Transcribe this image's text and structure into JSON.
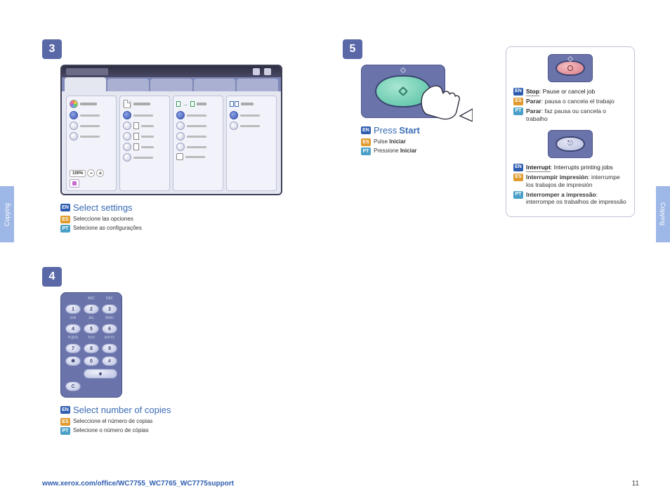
{
  "side_tab": "Copying",
  "footer": {
    "url": "www.xerox.com/office/WC7755_WC7765_WC7775support",
    "page": "11"
  },
  "step3": {
    "num": "3",
    "scale_value": "100%",
    "title": "Select settings",
    "es": "Seleccione las opciones",
    "pt": "Selecione as configurações"
  },
  "step4": {
    "num": "4",
    "labels": {
      "abc": "ABC",
      "def": "DEF",
      "ghi": "GHI",
      "jkl": "JKL",
      "mno": "MNO",
      "pqrs": "PQRS",
      "tuv": "TUV",
      "wxyz": "WXYZ"
    },
    "keys": {
      "k1": "1",
      "k2": "2",
      "k3": "3",
      "k4": "4",
      "k5": "5",
      "k6": "6",
      "k7": "7",
      "k8": "8",
      "k9": "9",
      "k0": "0",
      "star": "✱",
      "hash": "#",
      "c": "C"
    },
    "title": "Select number of copies",
    "es": "Seleccione el número de copias",
    "pt": "Selecione o número de cópias"
  },
  "step5": {
    "num": "5",
    "title_prefix": "Press",
    "title_strong": "Start",
    "es_prefix": "Pulse",
    "es_strong": "Iniciar",
    "pt_prefix": "Pressione",
    "pt_strong": "Iniciar"
  },
  "info": {
    "stop": {
      "en_b": "Stop",
      "en_rest": ": Pause or cancel job",
      "es_b": "Parar",
      "es_rest": ": pausa o cancela el trabajo",
      "pt_b": "Parar",
      "pt_rest": ": faz pausa ou cancela o trabalho"
    },
    "intr": {
      "en_b": "Interrupt",
      "en_rest": ": Interrupts printing jobs",
      "es_b": "Interrumpir impresión",
      "es_rest": ": interrumpe los trabajos de impresión",
      "pt_b": "Interromper a impressão",
      "pt_rest": ": interrompe os trabalhos de impressão"
    }
  },
  "lang": {
    "en": "EN",
    "es": "ES",
    "pt": "PT"
  }
}
